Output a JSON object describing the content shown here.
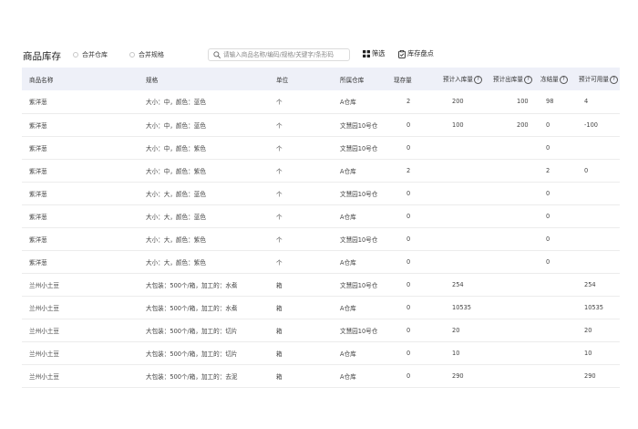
{
  "header": {
    "title": "商品库存",
    "radio_merge_warehouse": "合并仓库",
    "radio_merge_spec": "合并规格",
    "search_placeholder": "请输入商品名称/编码/规格/关键字/条形码",
    "filter_label": "筛选",
    "stocktake_label": "库存盘点"
  },
  "table": {
    "columns": {
      "name": "商品名称",
      "spec": "规格",
      "unit": "单位",
      "warehouse": "所属仓库",
      "stock": "现存量",
      "expected_in": "预计入库量",
      "expected_out": "预计出库量",
      "frozen": "冻结量",
      "expected_available": "预计可用量"
    },
    "help_glyph": "?",
    "rows": [
      {
        "name": "紫洋葱",
        "spec": "大小：中，颜色：蓝色",
        "unit": "个",
        "warehouse": "A仓库",
        "stock": "2",
        "expected_in": "200",
        "expected_out": "100",
        "frozen": "98",
        "expected_available": "4"
      },
      {
        "name": "紫洋葱",
        "spec": "大小：中，颜色：蓝色",
        "unit": "个",
        "warehouse": "文慧园10号仓",
        "stock": "0",
        "expected_in": "100",
        "expected_out": "200",
        "frozen": "0",
        "expected_available": "-100"
      },
      {
        "name": "紫洋葱",
        "spec": "大小：中，颜色：紫色",
        "unit": "个",
        "warehouse": "文慧园10号仓",
        "stock": "0",
        "expected_in": "",
        "expected_out": "",
        "frozen": "0",
        "expected_available": ""
      },
      {
        "name": "紫洋葱",
        "spec": "大小：中，颜色：紫色",
        "unit": "个",
        "warehouse": "A仓库",
        "stock": "2",
        "expected_in": "",
        "expected_out": "",
        "frozen": "2",
        "expected_available": "0"
      },
      {
        "name": "紫洋葱",
        "spec": "大小：大，颜色：蓝色",
        "unit": "个",
        "warehouse": "文慧园10号仓",
        "stock": "0",
        "expected_in": "",
        "expected_out": "",
        "frozen": "0",
        "expected_available": ""
      },
      {
        "name": "紫洋葱",
        "spec": "大小：大，颜色：蓝色",
        "unit": "个",
        "warehouse": "A仓库",
        "stock": "0",
        "expected_in": "",
        "expected_out": "",
        "frozen": "0",
        "expected_available": ""
      },
      {
        "name": "紫洋葱",
        "spec": "大小：大，颜色：紫色",
        "unit": "个",
        "warehouse": "文慧园10号仓",
        "stock": "0",
        "expected_in": "",
        "expected_out": "",
        "frozen": "0",
        "expected_available": ""
      },
      {
        "name": "紫洋葱",
        "spec": "大小：大，颜色：紫色",
        "unit": "个",
        "warehouse": "A仓库",
        "stock": "0",
        "expected_in": "",
        "expected_out": "",
        "frozen": "0",
        "expected_available": ""
      },
      {
        "name": "兰州小土豆",
        "spec": "大包装：500个/箱，加工的：水煮",
        "unit": "箱",
        "warehouse": "文慧园10号仓",
        "stock": "0",
        "expected_in": "254",
        "expected_out": "",
        "frozen": "",
        "expected_available": "254"
      },
      {
        "name": "兰州小土豆",
        "spec": "大包装：500个/箱，加工的：水煮",
        "unit": "箱",
        "warehouse": "A仓库",
        "stock": "0",
        "expected_in": "10535",
        "expected_out": "",
        "frozen": "",
        "expected_available": "10535"
      },
      {
        "name": "兰州小土豆",
        "spec": "大包装：500个/箱，加工的：切片",
        "unit": "箱",
        "warehouse": "文慧园10号仓",
        "stock": "0",
        "expected_in": "20",
        "expected_out": "",
        "frozen": "",
        "expected_available": "20"
      },
      {
        "name": "兰州小土豆",
        "spec": "大包装：500个/箱，加工的：切片",
        "unit": "箱",
        "warehouse": "A仓库",
        "stock": "0",
        "expected_in": "10",
        "expected_out": "",
        "frozen": "",
        "expected_available": "10"
      },
      {
        "name": "兰州小土豆",
        "spec": "大包装：500个/箱，加工的：去泥",
        "unit": "箱",
        "warehouse": "A仓库",
        "stock": "0",
        "expected_in": "290",
        "expected_out": "",
        "frozen": "",
        "expected_available": "290"
      }
    ]
  },
  "icons": {
    "search": "search-icon",
    "filter": "grid-icon",
    "stocktake": "clipboard-icon"
  }
}
